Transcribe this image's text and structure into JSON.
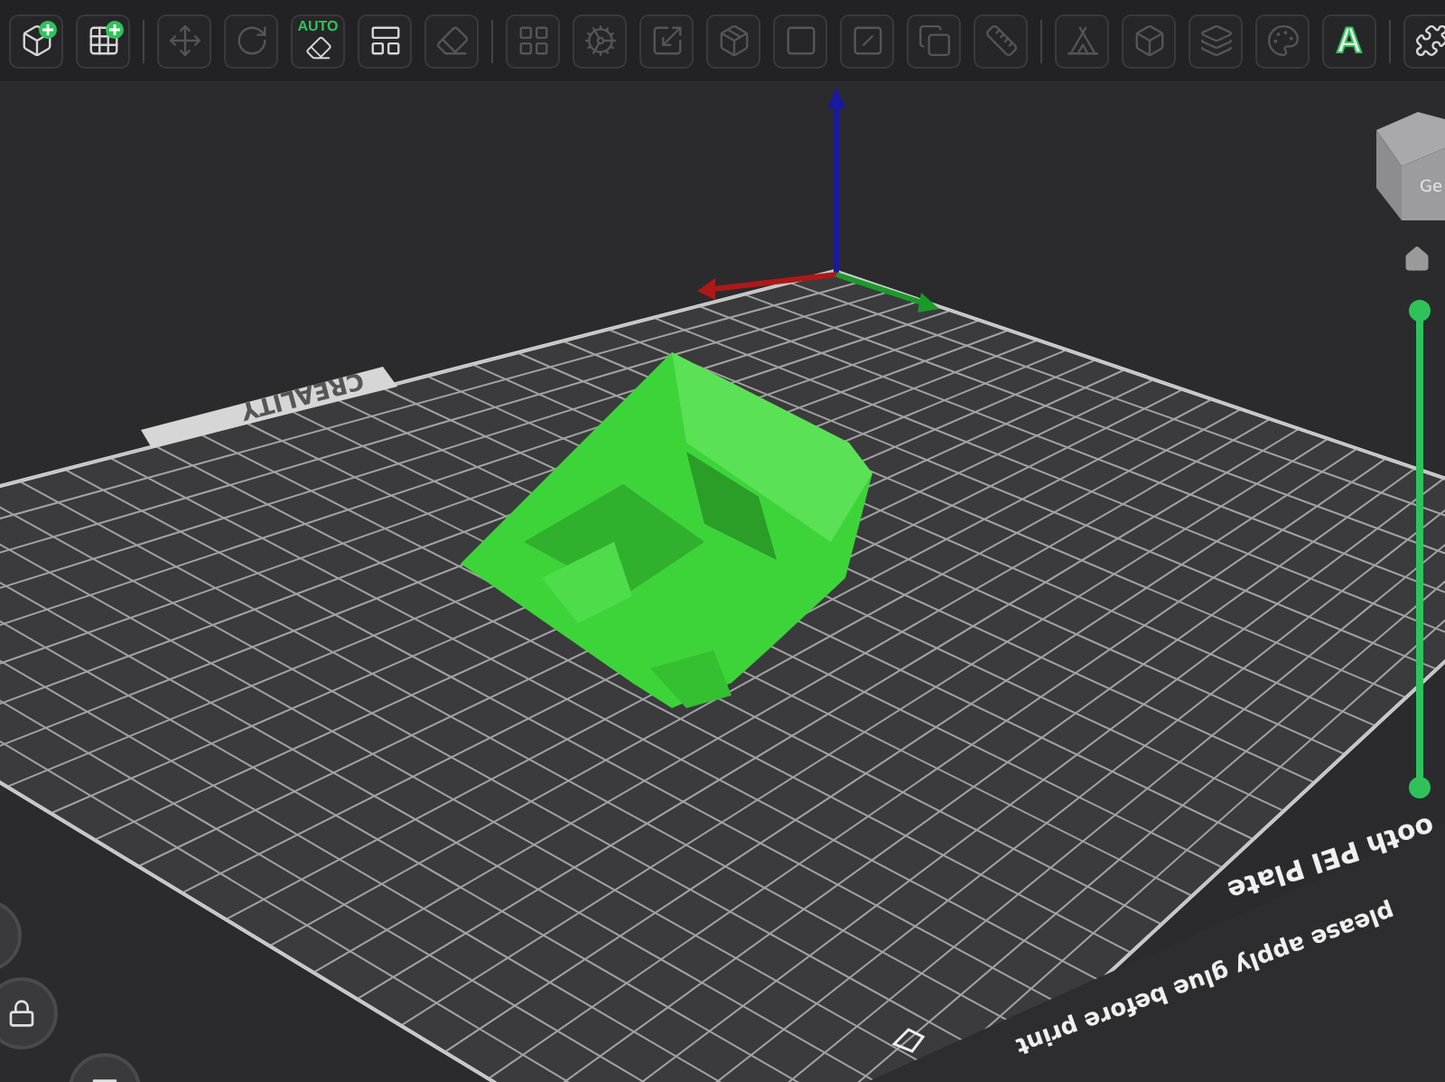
{
  "toolbar": {
    "groups": [
      {
        "buttons": [
          {
            "disabled": false
          },
          {
            "disabled": false
          }
        ]
      },
      {
        "buttons": [
          {
            "disabled": true
          },
          {
            "disabled": true
          },
          {
            "disabled": false,
            "badge": "AUTO"
          },
          {
            "disabled": false
          },
          {
            "disabled": true
          }
        ]
      },
      {
        "buttons": [
          {
            "disabled": true
          },
          {
            "disabled": true
          },
          {
            "disabled": true
          },
          {
            "disabled": true
          },
          {
            "disabled": true
          },
          {
            "disabled": true
          },
          {
            "disabled": true
          },
          {
            "disabled": true
          }
        ]
      },
      {
        "buttons": [
          {
            "disabled": true
          },
          {
            "disabled": true
          },
          {
            "disabled": true
          },
          {
            "disabled": true
          },
          {
            "disabled": false,
            "label": "A"
          }
        ]
      },
      {
        "buttons": [
          {
            "disabled": false
          }
        ]
      }
    ]
  },
  "viewport": {
    "plate_brand": "CREALITY",
    "plate_name": "ooth PEI Plate",
    "plate_note": "please apply glue before print",
    "view_cube": {
      "face": "Ge"
    }
  },
  "layer_slider": {
    "upper": {
      "level": 1
    },
    "lower": {
      "level": 0
    }
  }
}
